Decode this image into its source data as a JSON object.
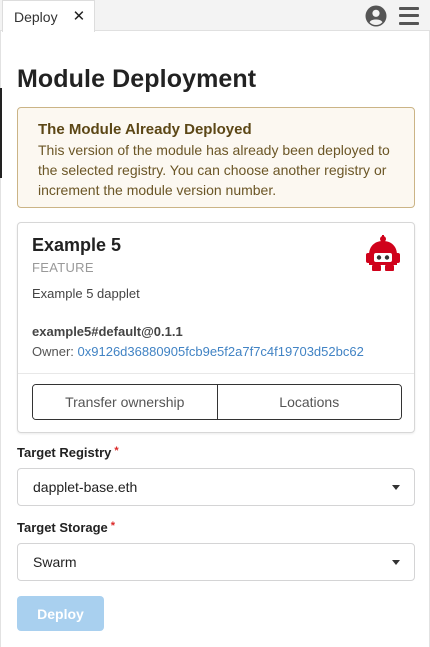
{
  "tab": {
    "label": "Deploy",
    "close_glyph": "✕"
  },
  "toolbar": {
    "account_icon": "account-icon",
    "menu_icon": "hamburger-menu-icon"
  },
  "page": {
    "title": "Module Deployment"
  },
  "warning": {
    "title": "The Module Already Deployed",
    "text": "This version of the module has already been deployed to the selected registry. You can choose another registry or increment the module version number."
  },
  "module": {
    "name": "Example 5",
    "type": "FEATURE",
    "description": "Example 5 dapplet",
    "id": "example5#default@0.1.1",
    "owner_label": "Owner:",
    "owner_address": "0x9126d36880905fcb9e5f2a7f7c4f19703d52bc62",
    "transfer_label": "Transfer ownership",
    "locations_label": "Locations"
  },
  "target_registry": {
    "label": "Target Registry",
    "required_mark": "*",
    "value": "dapplet-base.eth"
  },
  "target_storage": {
    "label": "Target Storage",
    "required_mark": "*",
    "value": "Swarm"
  },
  "deploy": {
    "label": "Deploy"
  },
  "colors": {
    "accent": "#4183c4",
    "required": "#db2828",
    "deploy_disabled": "#a9d0ef",
    "warning_bg": "#fcf8f1",
    "warning_border": "#cbb486"
  }
}
